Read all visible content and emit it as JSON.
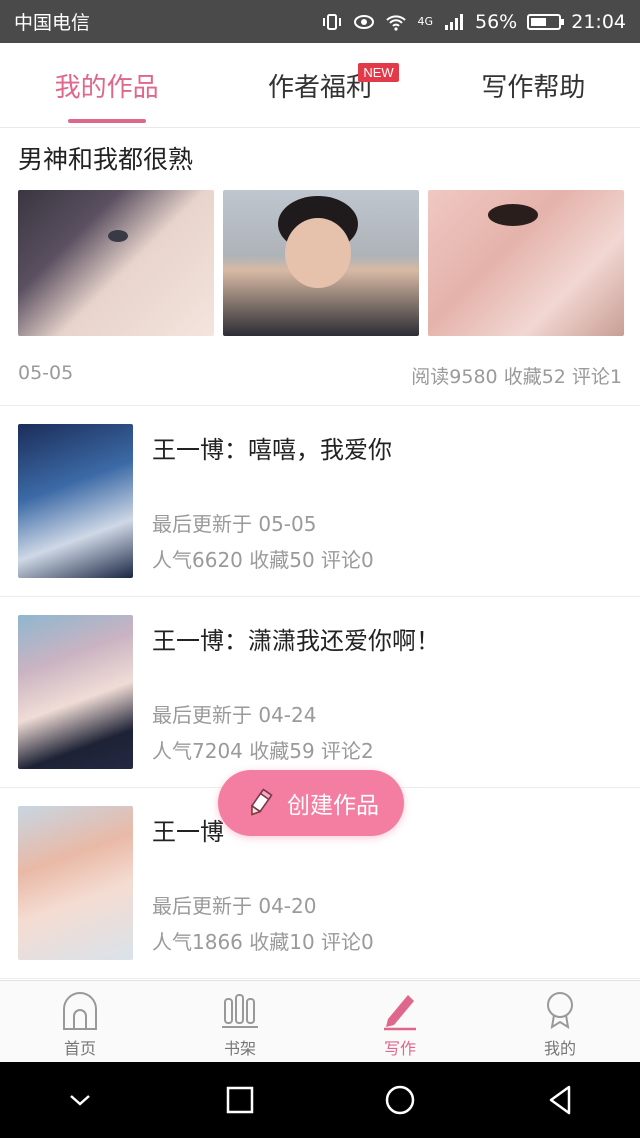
{
  "status_bar": {
    "carrier": "中国电信",
    "network": "4G",
    "battery_percent": "56%",
    "battery_level": 0.56,
    "time": "21:04"
  },
  "tabs": [
    {
      "label": "我的作品",
      "active": true
    },
    {
      "label": "作者福利",
      "badge": "NEW"
    },
    {
      "label": "写作帮助"
    }
  ],
  "featured": {
    "title": "男神和我都很熟",
    "date": "05-05",
    "stats": "阅读9580 收藏52 评论1"
  },
  "works": [
    {
      "title": "王一博：嘻嘻，我爱你",
      "updated": "最后更新于 05-05",
      "stats": "人气6620 收藏50 评论0"
    },
    {
      "title": "王一博：潇潇我还爱你啊！",
      "updated": "最后更新于 04-24",
      "stats": "人气7204 收藏59 评论2"
    },
    {
      "title": "王一博",
      "updated": "最后更新于 04-20",
      "stats": "人气1866 收藏10 评论0"
    }
  ],
  "create_button": {
    "label": "创建作品"
  },
  "bottom_nav": [
    {
      "label": "首页",
      "icon": "home-icon"
    },
    {
      "label": "书架",
      "icon": "bookshelf-icon"
    },
    {
      "label": "写作",
      "icon": "pen-icon",
      "active": true
    },
    {
      "label": "我的",
      "icon": "profile-icon"
    }
  ],
  "colors": {
    "accent": "#e0678c",
    "button": "#f47ea1",
    "badge": "#e23a48"
  }
}
